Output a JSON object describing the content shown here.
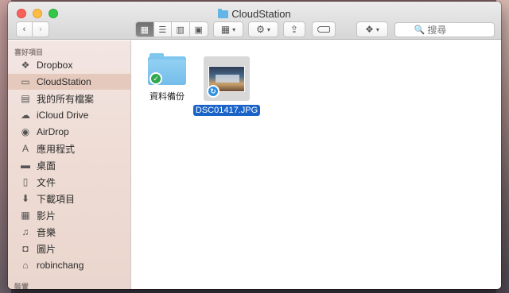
{
  "window": {
    "title": "CloudStation"
  },
  "toolbar": {
    "view_modes": [
      "icon",
      "list",
      "column",
      "cover-flow"
    ],
    "search_placeholder": "搜尋"
  },
  "sidebar": {
    "favorites_header": "喜好項目",
    "items": [
      {
        "label": "Dropbox",
        "icon": "dropbox-icon",
        "glyph": "❖"
      },
      {
        "label": "CloudStation",
        "icon": "folder-icon",
        "glyph": "▭"
      },
      {
        "label": "我的所有檔案",
        "icon": "all-files-icon",
        "glyph": "▤"
      },
      {
        "label": "iCloud Drive",
        "icon": "cloud-icon",
        "glyph": "☁"
      },
      {
        "label": "AirDrop",
        "icon": "airdrop-icon",
        "glyph": "◉"
      },
      {
        "label": "應用程式",
        "icon": "applications-icon",
        "glyph": "A"
      },
      {
        "label": "桌面",
        "icon": "desktop-icon",
        "glyph": "▬"
      },
      {
        "label": "文件",
        "icon": "documents-icon",
        "glyph": "▯"
      },
      {
        "label": "下載項目",
        "icon": "downloads-icon",
        "glyph": "⬇"
      },
      {
        "label": "影片",
        "icon": "movies-icon",
        "glyph": "▦"
      },
      {
        "label": "音樂",
        "icon": "music-icon",
        "glyph": "♫"
      },
      {
        "label": "圖片",
        "icon": "pictures-icon",
        "glyph": "◘"
      },
      {
        "label": "robinchang",
        "icon": "home-icon",
        "glyph": "⌂"
      }
    ],
    "selected_index": 1,
    "devices_header": "裝置"
  },
  "files": [
    {
      "name": "資料備份",
      "type": "folder",
      "status": "synced"
    },
    {
      "name": "DSC01417.JPG",
      "type": "image",
      "status": "syncing",
      "selected": true
    }
  ],
  "colors": {
    "selection_blue": "#1a63c7",
    "sidebar_selected": "#e5c9bc",
    "folder_blue": "#7fc6ef",
    "synced_green": "#2fa84f",
    "syncing_blue": "#2e8fe0"
  }
}
